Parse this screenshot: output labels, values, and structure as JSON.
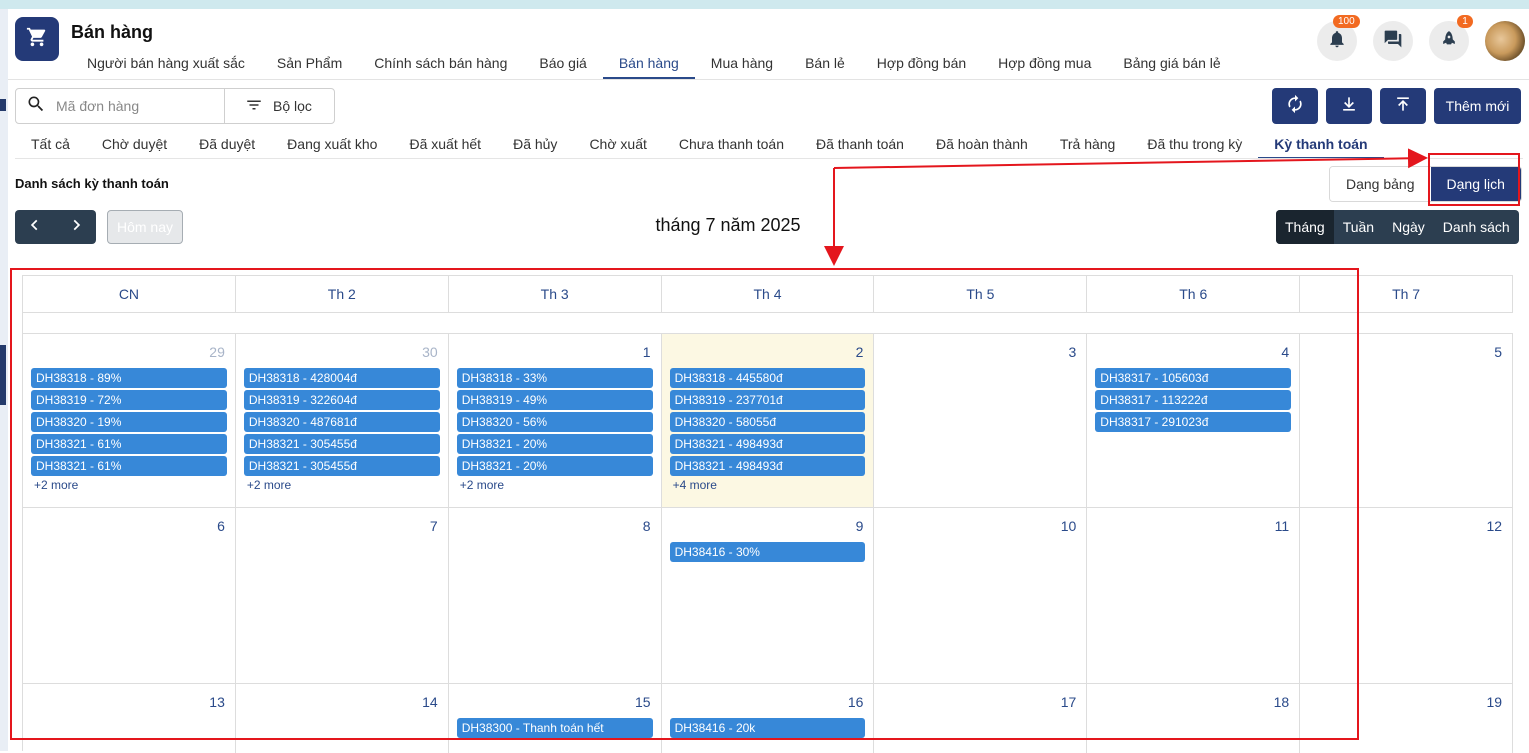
{
  "app": {
    "title": "Bán hàng",
    "icon": "cart-icon"
  },
  "nav": {
    "items": [
      "Người bán hàng xuất sắc",
      "Sản Phẩm",
      "Chính sách bán hàng",
      "Báo giá",
      "Bán hàng",
      "Mua hàng",
      "Bán lẻ",
      "Hợp đồng bán",
      "Hợp đồng mua",
      "Bảng giá bán lẻ"
    ],
    "active": "Bán hàng"
  },
  "header_icons": {
    "notifications_badge": "100",
    "rocket_badge": "1"
  },
  "search": {
    "placeholder": "Mã đơn hàng",
    "filter_label": "Bộ lọc"
  },
  "actions": {
    "add_label": "Thêm mới"
  },
  "status_tabs": {
    "items": [
      "Tất cả",
      "Chờ duyệt",
      "Đã duyệt",
      "Đang xuất kho",
      "Đã xuất hết",
      "Đã hủy",
      "Chờ xuất",
      "Chưa thanh toán",
      "Đã thanh toán",
      "Đã hoàn thành",
      "Trả hàng",
      "Đã thu trong kỳ",
      "Kỳ thanh toán"
    ],
    "active": "Kỳ thanh toán"
  },
  "list_title": "Danh sách kỳ thanh toán",
  "view_toggle": {
    "table": "Dạng bảng",
    "calendar": "Dạng lịch",
    "active": "calendar"
  },
  "calendar": {
    "title": "tháng 7 năm 2025",
    "today_label": "Hôm nay",
    "ranges": [
      "Tháng",
      "Tuần",
      "Ngày",
      "Danh sách"
    ],
    "active_range": "Tháng",
    "days_of_week": [
      "CN",
      "Th 2",
      "Th 3",
      "Th 4",
      "Th 5",
      "Th 6",
      "Th 7"
    ],
    "weeks": [
      [
        {
          "num": "29",
          "other": true,
          "events": [
            "DH38318 - 89%",
            "DH38319 - 72%",
            "DH38320 - 19%",
            "DH38321 - 61%",
            "DH38321 - 61%"
          ],
          "more": "+2 more"
        },
        {
          "num": "30",
          "other": true,
          "events": [
            "DH38318 - 428004đ",
            "DH38319 - 322604đ",
            "DH38320 - 487681đ",
            "DH38321 - 305455đ",
            "DH38321 - 305455đ"
          ],
          "more": "+2 more"
        },
        {
          "num": "1",
          "events": [
            "DH38318 - 33%",
            "DH38319 - 49%",
            "DH38320 - 56%",
            "DH38321 - 20%",
            "DH38321 - 20%"
          ],
          "more": "+2 more"
        },
        {
          "num": "2",
          "today": true,
          "events": [
            "DH38318 - 445580đ",
            "DH38319 - 237701đ",
            "DH38320 - 58055đ",
            "DH38321 - 498493đ",
            "DH38321 - 498493đ"
          ],
          "more": "+4 more"
        },
        {
          "num": "3",
          "events": []
        },
        {
          "num": "4",
          "events": [
            "DH38317 - 105603đ",
            "DH38317 - 113222đ",
            "DH38317 - 291023đ"
          ]
        },
        {
          "num": "5",
          "events": []
        }
      ],
      [
        {
          "num": "6",
          "events": []
        },
        {
          "num": "7",
          "events": []
        },
        {
          "num": "8",
          "events": []
        },
        {
          "num": "9",
          "events": [
            "DH38416 - 30%"
          ]
        },
        {
          "num": "10",
          "events": []
        },
        {
          "num": "11",
          "events": []
        },
        {
          "num": "12",
          "events": []
        }
      ],
      [
        {
          "num": "13",
          "events": []
        },
        {
          "num": "14",
          "events": []
        },
        {
          "num": "15",
          "events": [
            "DH38300 - Thanh toán hết"
          ]
        },
        {
          "num": "16",
          "events": [
            "DH38416 - 20k"
          ]
        },
        {
          "num": "17",
          "events": []
        },
        {
          "num": "18",
          "events": []
        },
        {
          "num": "19",
          "events": []
        }
      ]
    ]
  },
  "colors": {
    "primary": "#243a78",
    "event": "#3788d8",
    "annotation": "#e4161d",
    "today_bg": "#fcf8e3",
    "badge": "#f26a21"
  }
}
